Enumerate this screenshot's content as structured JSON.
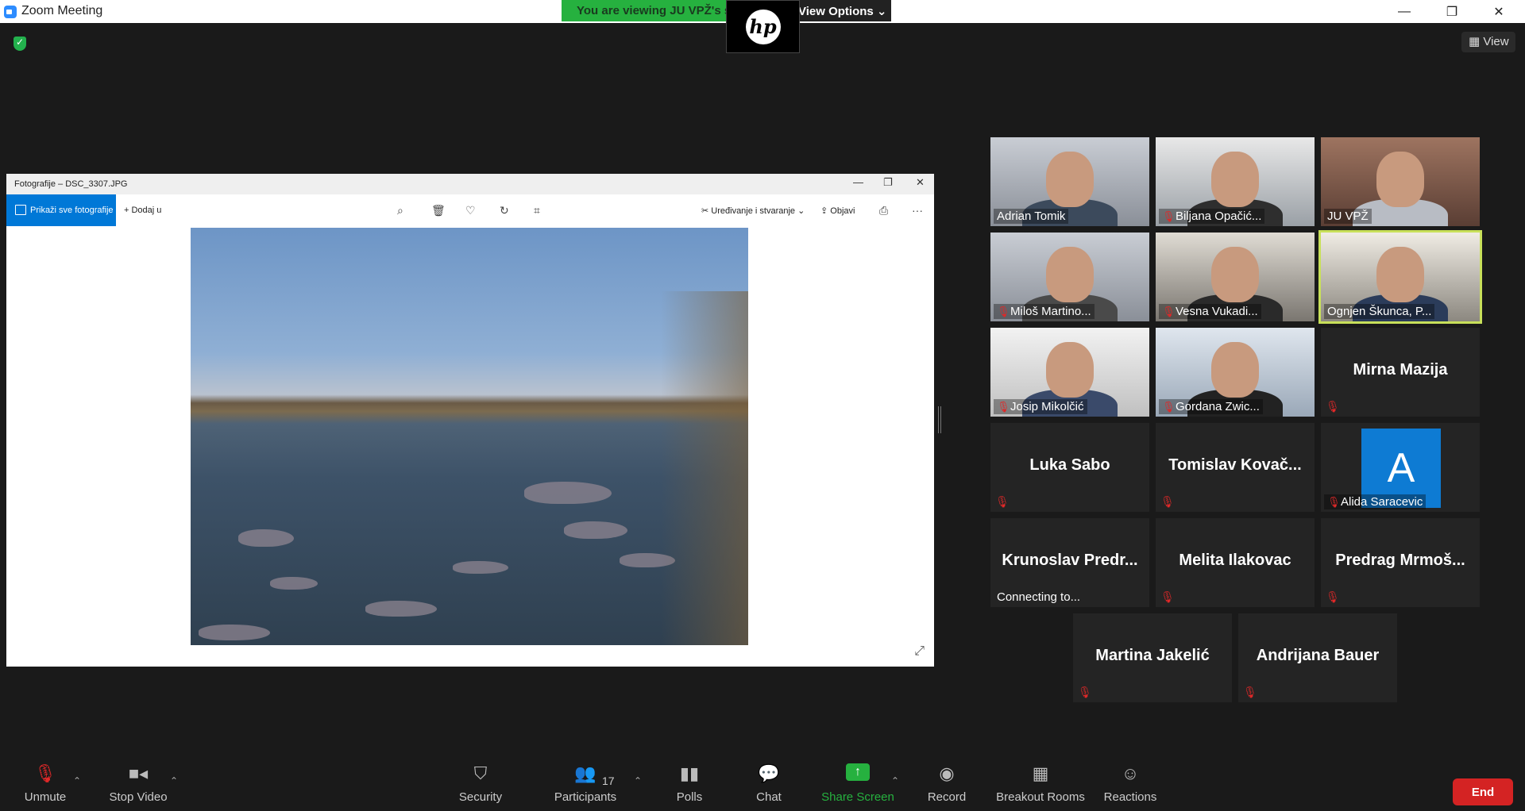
{
  "window": {
    "title": "Zoom Meeting",
    "minimize": "—",
    "restore": "❐",
    "close": "✕"
  },
  "banner": {
    "viewing": "You are viewing JU VPŽ's s",
    "view_options": "View Options ⌄"
  },
  "top": {
    "view_label": "View"
  },
  "photos_app": {
    "title": "Fotografije – DSC_3307.JPG",
    "show_all": "Prikaži sve fotografije",
    "add_to": "Dodaj u",
    "edit_create": "Uređivanje i stvaranje",
    "share": "Objavi",
    "more": "···"
  },
  "participants_tiles": [
    {
      "name": "Adrian Tomik",
      "muted": false,
      "video": true
    },
    {
      "name": "Biljana Opačić...",
      "muted": true,
      "video": true
    },
    {
      "name": "JU VPŽ",
      "muted": false,
      "video": true
    },
    {
      "name": "Miloš Martino...",
      "muted": true,
      "video": true
    },
    {
      "name": "Vesna Vukadi...",
      "muted": true,
      "video": true
    },
    {
      "name": "Ognjen Škunca, P...",
      "muted": false,
      "video": true,
      "active": true
    },
    {
      "name": "Josip Mikolčić",
      "muted": true,
      "video": true
    },
    {
      "name": "Gordana Zwic...",
      "muted": true,
      "video": true
    },
    {
      "name": "Mirna Mazija",
      "muted": true,
      "video": false
    },
    {
      "name": "Luka Sabo",
      "muted": true,
      "video": false
    },
    {
      "name": "Tomislav Kovač...",
      "muted": true,
      "video": false
    },
    {
      "name": "Alida Saracevic",
      "muted": true,
      "video": false,
      "avatar": "A"
    },
    {
      "name": "Krunoslav Predr...",
      "muted": false,
      "video": false,
      "status": "Connecting to..."
    },
    {
      "name": "Melita Ilakovac",
      "muted": true,
      "video": false
    },
    {
      "name": "Predrag Mrmoš...",
      "muted": true,
      "video": false
    },
    {
      "name": "Martina Jakelić",
      "muted": true,
      "video": false
    },
    {
      "name": "Andrijana Bauer",
      "muted": true,
      "video": false
    }
  ],
  "toolbar": {
    "unmute": "Unmute",
    "stop_video": "Stop Video",
    "security": "Security",
    "participants": "Participants",
    "participants_count": "17",
    "polls": "Polls",
    "chat": "Chat",
    "share_screen": "Share Screen",
    "record": "Record",
    "breakout_rooms": "Breakout Rooms",
    "reactions": "Reactions",
    "end": "End"
  },
  "colors": {
    "accent_green": "#26b13f",
    "end_red": "#d42323",
    "photos_blue": "#0078d7",
    "active_speaker": "#c8e05a"
  }
}
